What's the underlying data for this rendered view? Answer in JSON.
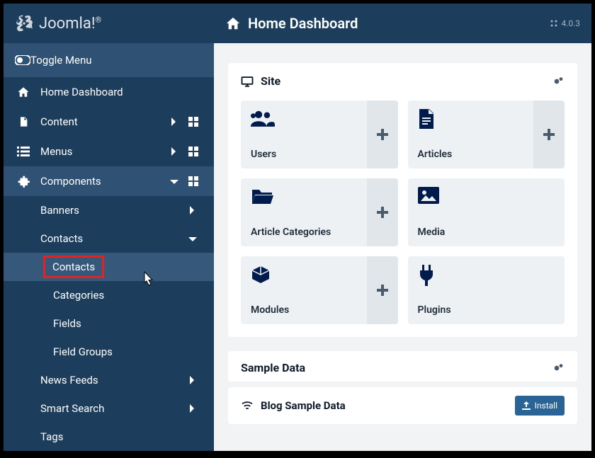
{
  "brand": "Joomla!",
  "version": "4.0.3",
  "topbar": {
    "title": "Home Dashboard"
  },
  "sidebar": {
    "toggle": "Toggle Menu",
    "items": {
      "home": "Home Dashboard",
      "content": "Content",
      "menus": "Menus",
      "components": "Components"
    },
    "components_children": {
      "banners": "Banners",
      "contacts": "Contacts",
      "contacts_children": {
        "contacts": "Contacts",
        "categories": "Categories",
        "fields": "Fields",
        "field_groups": "Field Groups"
      },
      "news_feeds": "News Feeds",
      "smart_search": "Smart Search",
      "tags": "Tags"
    }
  },
  "site_panel": {
    "title": "Site",
    "cards": {
      "users": "Users",
      "articles": "Articles",
      "article_categories": "Article Categories",
      "media": "Media",
      "modules": "Modules",
      "plugins": "Plugins"
    }
  },
  "sample_panel": {
    "title": "Sample Data"
  },
  "blog_panel": {
    "title": "Blog Sample Data",
    "install": "Install"
  }
}
